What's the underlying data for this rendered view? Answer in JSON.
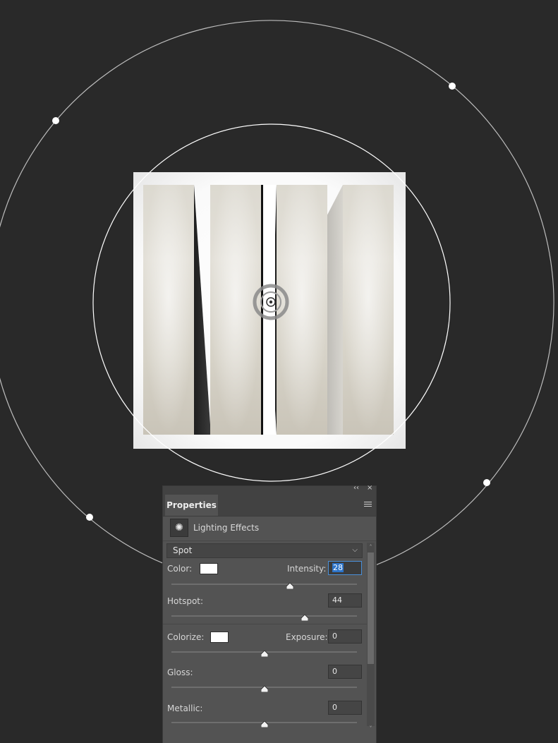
{
  "properties_panel": {
    "collapse_glyph": "‹‹",
    "close_glyph": "×",
    "tab_label": "Properties",
    "effect_name": "Lighting Effects",
    "light_type": "Spot",
    "color_label": "Color:",
    "intensity_label": "Intensity:",
    "intensity_value": "28",
    "intensity_level": 0.64,
    "hotspot_label": "Hotspot:",
    "hotspot_value": "44",
    "hotspot_level": 0.72,
    "colorize_label": "Colorize:",
    "exposure_label": "Exposure:",
    "exposure_value": "0",
    "exposure_level": 0.5,
    "gloss_label": "Gloss:",
    "gloss_value": "0",
    "gloss_level": 0.5,
    "metallic_label": "Metallic:",
    "metallic_value": "0",
    "metallic_level": 0.5
  },
  "colors": {
    "canvas_bg": "#292929",
    "panel_bg": "#535353",
    "light_color": "#ffffff",
    "colorize_color": "#ffffff",
    "accent": "#2d74c9"
  },
  "icons": {
    "effect_icon": "lighting-effects-icon",
    "menu_icon": "panel-menu-icon",
    "dropdown_icon": "chevron-down-icon"
  }
}
